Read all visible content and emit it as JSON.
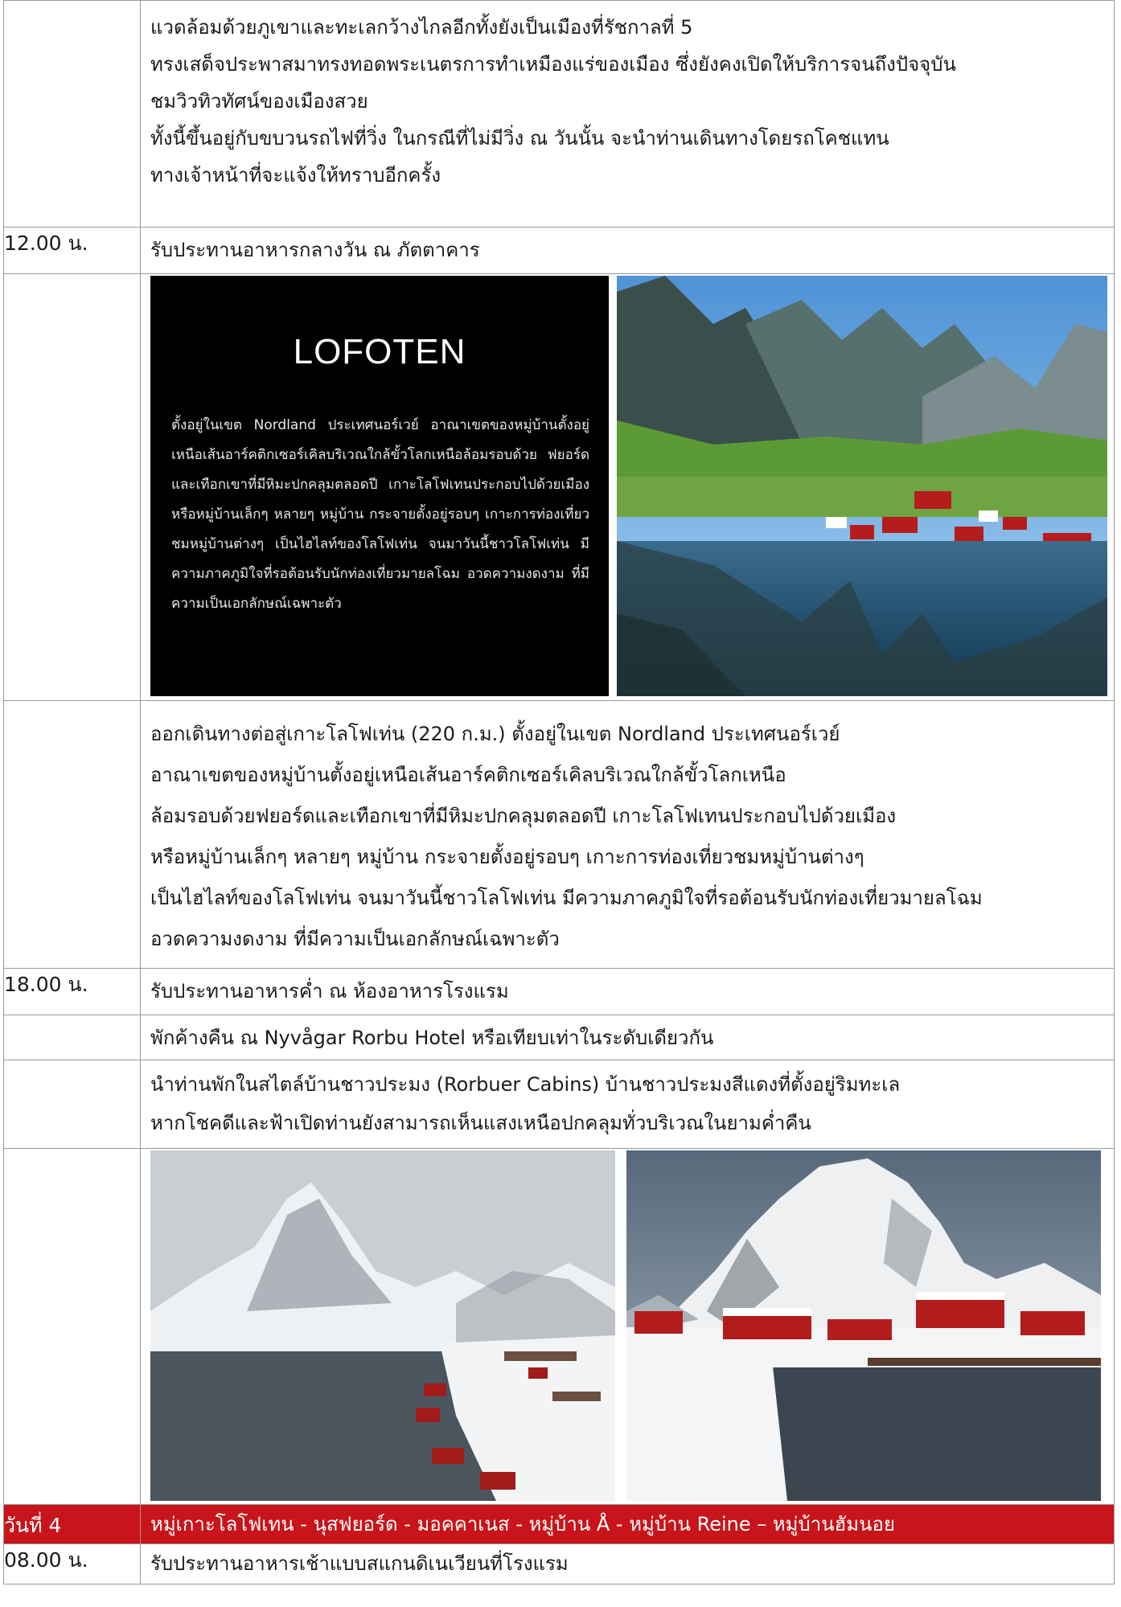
{
  "block_top": {
    "lines": [
      "แวดล้อมด้วยภูเขาและทะเลกว้างไกลอีกทั้งยังเป็นเมืองที่รัชกาลที่ 5",
      "ทรงเสด็จประพาสมาทรงทอดพระเนตรการทำเหมืองแร่ของเมือง ซึ่งยังคงเปิดให้บริการจนถึงปัจจุบัน",
      "ชมวิวทิวทัศน์ของเมืองสวย",
      "ทั้งนี้ขึ้นอยู่กับขบวนรถไฟที่วิ่ง ในกรณีที่ไม่มีวิ่ง ณ วันนั้น จะนำท่านเดินทางโดยรถโคชแทน",
      "ทางเจ้าหน้าที่จะแจ้งให้ทราบอีกครั้ง"
    ]
  },
  "lunch": {
    "time": "12.00 น.",
    "text": "รับประทานอาหารกลางวัน ณ ภัตตาคาร"
  },
  "lofoten_panel": {
    "title": "LOFOTEN",
    "text": "ตั้งอยู่ในเขต Nordland ประเทศนอร์เวย์ อาณาเขตของหมู่บ้านตั้งอยู่เหนือเส้นอาร์คติกเซอร์เคิลบริเวณใกล้ขั้วโลกเหนือล้อมรอบด้วย ฟยอร์ดและเทือกเขาที่มีหิมะปกคลุมตลอดปี เกาะโลโฟเทนประกอบไปด้วยเมือง หรือหมู่บ้านเล็กๆ หลายๆ หมู่บ้าน กระจายตั้งอยู่รอบๆ เกาะการท่องเที่ยวชมหมู่บ้านต่างๆ เป็นไฮไลท์ของโลโฟเท่น จนมาวันนี้ชาวโลโฟเท่น มีความภาคภูมิใจที่รอต้อนรับนักท่องเที่ยวมายลโฉม อวดความงดงาม ที่มีความเป็นเอกลักษณ์เฉพาะตัว"
  },
  "block_lofoten": {
    "lines": [
      "ออกเดินทางต่อสู่เกาะโลโฟเท่น (220 ก.ม.) ตั้งอยู่ในเขต Nordland ประเทศนอร์เวย์",
      "อาณาเขตของหมู่บ้านตั้งอยู่เหนือเส้นอาร์คติกเซอร์เคิลบริเวณใกล้ขั้วโลกเหนือ",
      "ล้อมรอบด้วยฟยอร์ดและเทือกเขาที่มีหิมะปกคลุมตลอดปี เกาะโลโฟเทนประกอบไปด้วยเมือง",
      "หรือหมู่บ้านเล็กๆ หลายๆ หมู่บ้าน กระจายตั้งอยู่รอบๆ เกาะการท่องเที่ยวชมหมู่บ้านต่างๆ",
      "เป็นไฮไลท์ของโลโฟเท่น จนมาวันนี้ชาวโลโฟเท่น มีความภาคภูมิใจที่รอต้อนรับนักท่องเที่ยวมายลโฉม",
      "อวดความงดงาม ที่มีความเป็นเอกลักษณ์เฉพาะตัว"
    ]
  },
  "dinner": {
    "time": "18.00 น.",
    "text": "รับประทานอาหารค่ำ ณ ห้องอาหารโรงแรม"
  },
  "hotel": {
    "text": "พักค้างคืน ณ Nyvågar Rorbu Hotel หรือเทียบเท่าในระดับเดียวกัน"
  },
  "block_cabins": {
    "lines": [
      "นำท่านพักในสไตล์บ้านชาวประมง (Rorbuer Cabins) บ้านชาวประมงสีแดงที่ตั้งอยู่ริมทะเล",
      "หากโชคดีและฟ้าเปิดท่านยังสามารถเห็นแสงเหนือปกคลุมทั่วบริเวณในยามค่ำคืน"
    ]
  },
  "day4": {
    "label": "วันที่ 4",
    "route": "หมู่เกาะโลโฟเทน - นุสฟยอร์ด - มอคคาเนส - หมู่บ้าน Å - หมู่บ้าน Reine – หมู่บ้านฮัมนอย"
  },
  "breakfast": {
    "time": "08.00 น.",
    "text": "รับประทานอาหารเช้าแบบสแกนดิเนเวียนที่โรงแรม"
  },
  "colors": {
    "day_header": "#c8141a",
    "border": "#9a9a9a"
  }
}
